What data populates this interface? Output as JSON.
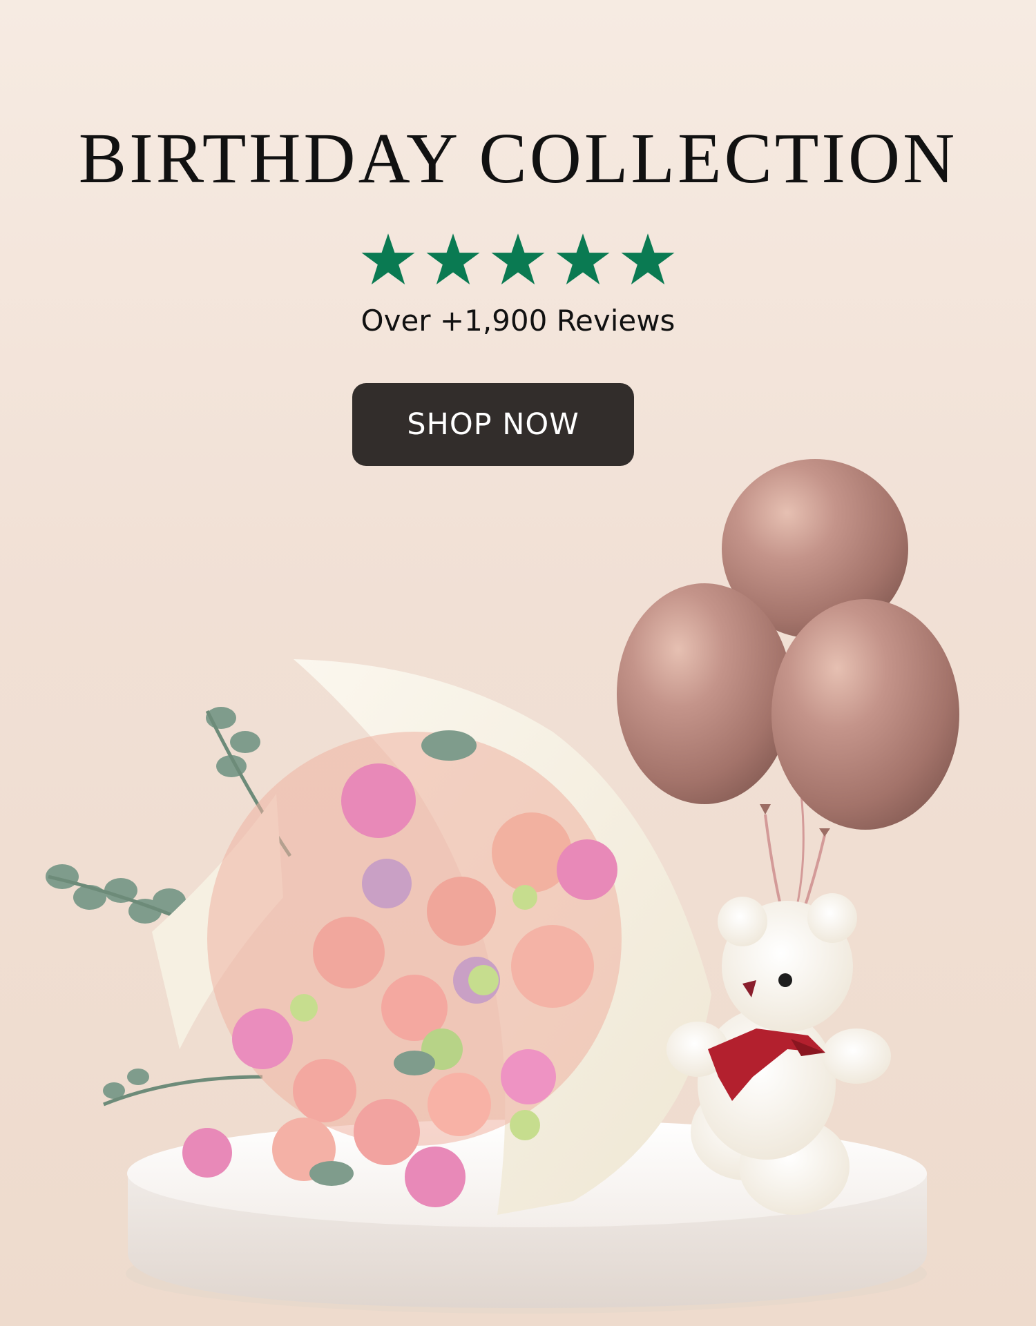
{
  "hero": {
    "title": "BIRTHDAY COLLECTION",
    "rating": {
      "stars": 5,
      "max_stars": 5,
      "star_color": "#0a7a52",
      "reviews_text": "Over +1,900 Reviews"
    },
    "cta": {
      "label": "SHOP NOW",
      "background_color": "#322d2b"
    }
  },
  "product_image": {
    "subjects": [
      "flower-bouquet",
      "balloons",
      "teddy-bear",
      "display-pedestal"
    ],
    "colors": {
      "balloons": "#b98579",
      "ribbon": "#b3202e",
      "background": "#f3e4da"
    }
  }
}
